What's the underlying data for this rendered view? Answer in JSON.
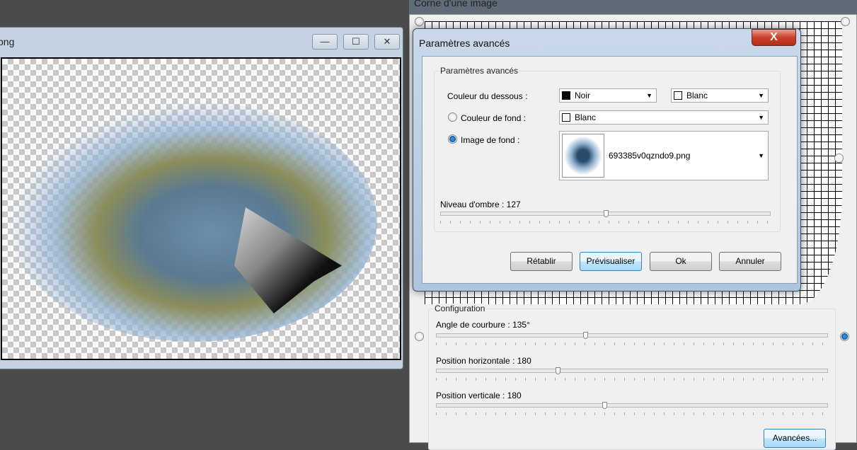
{
  "image_window": {
    "title": "png",
    "minimize": "—",
    "maximize": "☐",
    "close": "✕"
  },
  "main_dialog": {
    "title": "Corne d'une image",
    "configuration": {
      "label": "Configuration",
      "sliders": [
        {
          "label": "Angle de courbure : 135°",
          "value_fraction": 0.38
        },
        {
          "label": "Position horizontale : 180",
          "value_fraction": 0.31
        },
        {
          "label": "Position verticale : 180",
          "value_fraction": 0.43
        }
      ]
    },
    "advanced_button": "Avancées..."
  },
  "modal": {
    "title": "Paramètres avancés",
    "close": "X",
    "group_label": "Paramètres avancés",
    "under_color_label": "Couleur du dessous :",
    "under_color_1": "Noir",
    "under_color_2": "Blanc",
    "bg_color_label": "Couleur de fond :",
    "bg_color_value": "Blanc",
    "bg_image_label": "Image de fond :",
    "bg_image_value": "693385v0qzndo9.png",
    "shadow_label": "Niveau d'ombre : 127",
    "shadow_fraction": 0.5,
    "buttons": {
      "reset": "Rétablir",
      "preview": "Prévisualiser",
      "ok": "Ok",
      "cancel": "Annuler"
    },
    "colors": {
      "noir": "#000000",
      "blanc": "#ffffff"
    }
  }
}
